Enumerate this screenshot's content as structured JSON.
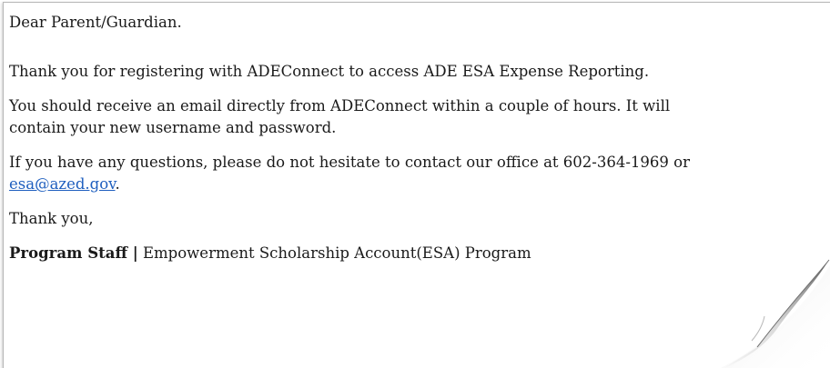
{
  "letter": {
    "salutation": "Dear Parent/Guardian.",
    "thanks_registration": "Thank you for registering with ADEConnect to access ADE ESA Expense Reporting.",
    "email_line_1": "You should receive an email directly from ADEConnect within a couple of hours. It will",
    "email_line_2": "contain your new username and password.",
    "questions_line": "If you have any questions, please do not hesitate to contact our office at 602-364-1969 or",
    "email_link": "esa@azed.gov",
    "email_link_suffix": ".",
    "closing": "Thank you,",
    "signature_name": "Program Staff |",
    "signature_program": " Empowerment Scholarship Account(ESA) Program"
  },
  "colors": {
    "link": "#1f5fbf",
    "text": "#1a1a1a",
    "page_fold": "#8a8a8a"
  }
}
